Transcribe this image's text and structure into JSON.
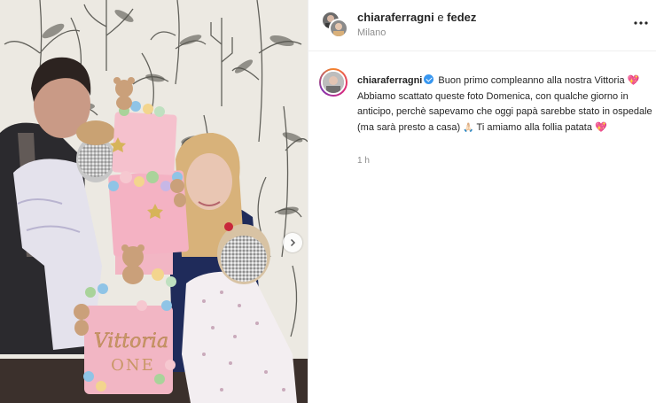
{
  "post": {
    "header": {
      "user1": "chiaraferragni",
      "separator": " e ",
      "user2": "fedez",
      "location": "Milano"
    },
    "caption": {
      "username": "chiaraferragni",
      "part1": " Buon primo compleanno alla nostra Vittoria ",
      "heart1": "💖",
      "part2": " Abbiamo scattato queste foto Domenica, con qualche giorno in anticipo, perchè sapevamo che oggi papà sarebbe stato in ospedale (ma sarà presto a casa) ",
      "hands": "🙏🏻",
      "part3": " Ti amiamo alla follia patata ",
      "heart2": "💖"
    },
    "timestamp": "1 h",
    "cake_topper": "Vittoria",
    "cake_topper_2": "ONE"
  },
  "icons": {
    "more": "more-horizontal-icon",
    "carousel_next": "chevron-right-icon",
    "verified": "verified-badge-icon"
  },
  "colors": {
    "verified": "#3897f0",
    "text": "#262626",
    "muted": "#8e8e8e",
    "cake_pink": "#f2b6c4"
  }
}
